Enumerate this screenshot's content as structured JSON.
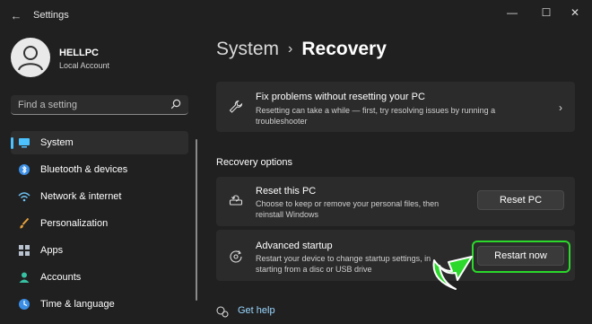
{
  "window": {
    "app_title": "Settings",
    "controls": {
      "minimize": "—",
      "maximize": "☐",
      "close": "✕"
    }
  },
  "user": {
    "name": "HELLPC",
    "account_type": "Local Account"
  },
  "search": {
    "placeholder": "Find a setting"
  },
  "sidebar": {
    "items": [
      {
        "label": "System",
        "icon": "monitor-icon",
        "active": true
      },
      {
        "label": "Bluetooth & devices",
        "icon": "bluetooth-icon"
      },
      {
        "label": "Network & internet",
        "icon": "wifi-icon"
      },
      {
        "label": "Personalization",
        "icon": "brush-icon"
      },
      {
        "label": "Apps",
        "icon": "apps-icon"
      },
      {
        "label": "Accounts",
        "icon": "person-icon"
      },
      {
        "label": "Time & language",
        "icon": "globe-clock-icon"
      }
    ]
  },
  "breadcrumb": {
    "parent": "System",
    "separator": "›",
    "current": "Recovery"
  },
  "fix_card": {
    "title": "Fix problems without resetting your PC",
    "description": "Resetting can take a while — first, try resolving issues by running a troubleshooter"
  },
  "recovery_options": {
    "section_title": "Recovery options",
    "reset": {
      "title": "Reset this PC",
      "description": "Choose to keep or remove your personal files, then reinstall Windows",
      "button": "Reset PC"
    },
    "advanced": {
      "title": "Advanced startup",
      "description": "Restart your device to change startup settings, in starting from a disc or USB drive",
      "button": "Restart now"
    }
  },
  "help": {
    "label": "Get help"
  },
  "colors": {
    "accent": "#4cc2ff",
    "highlight": "#2bd82b",
    "background": "#202020",
    "card": "#2b2b2b"
  }
}
